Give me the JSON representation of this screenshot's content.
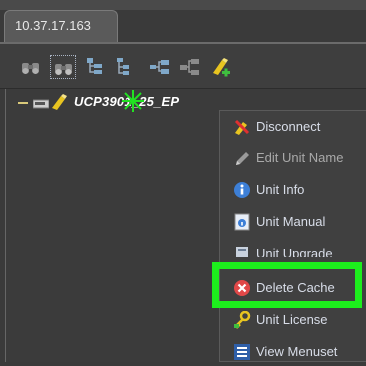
{
  "tab": {
    "label": "10.37.17.163"
  },
  "tree": {
    "node_label": "UCP3901_25_EP"
  },
  "context_menu": {
    "items": [
      {
        "label": "Disconnect",
        "icon": "disconnect-icon",
        "enabled": true
      },
      {
        "label": "Edit Unit Name",
        "icon": "pencil-icon",
        "enabled": false
      },
      {
        "label": "Unit Info",
        "icon": "info-icon",
        "enabled": true
      },
      {
        "label": "Unit Manual",
        "icon": "manual-icon",
        "enabled": true
      },
      {
        "label": "Unit Upgrade",
        "icon": "upgrade-icon",
        "enabled": true
      },
      {
        "label": "Delete Cache",
        "icon": "delete-cache-icon",
        "enabled": true
      },
      {
        "label": "Unit License",
        "icon": "license-key-icon",
        "enabled": true
      },
      {
        "label": "View Menuset",
        "icon": "menuset-icon",
        "enabled": true
      }
    ]
  },
  "colors": {
    "highlight": "#1dee1d",
    "background": "#3a3a3a"
  }
}
